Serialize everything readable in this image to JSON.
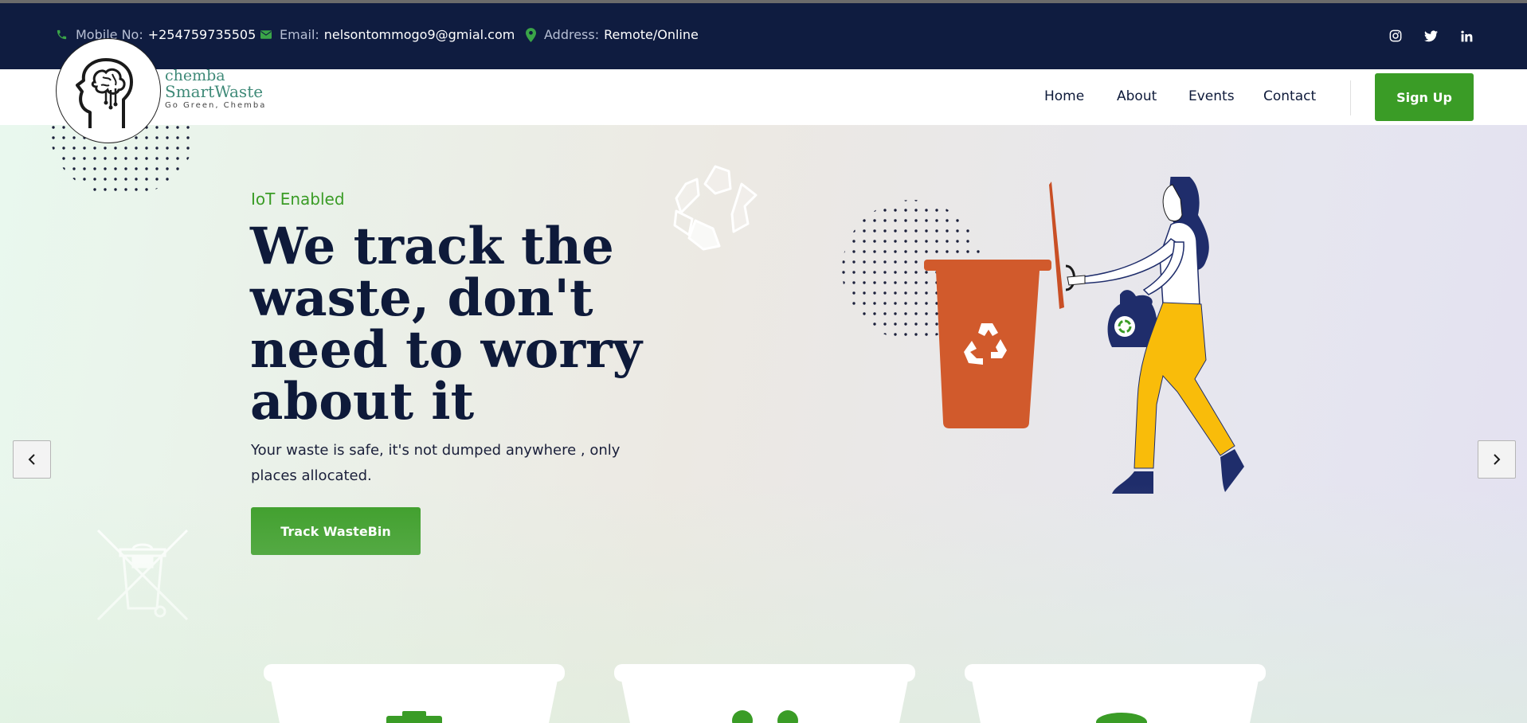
{
  "topbar": {
    "mobile_label": "Mobile No:",
    "mobile_value": "+254759735505",
    "email_label": "Email:",
    "email_value": "nelsontommogo9@gmial.com",
    "address_label": "Address:",
    "address_value": "Remote/Online",
    "social": [
      "instagram-icon",
      "twitter-icon",
      "linkedin-icon"
    ]
  },
  "logo": {
    "brand": "chemba",
    "name": "SmartWaste",
    "tagline": "Go Green, Chemba"
  },
  "nav": {
    "items": [
      "Home",
      "About",
      "Events",
      "Contact"
    ],
    "signup": "Sign Up"
  },
  "hero": {
    "eyebrow": "IoT Enabled",
    "headline": "We track the waste, don't need to worry about it",
    "subtext": "Your waste is safe, it's not dumped anywhere , only places allocated.",
    "cta": "Track WasteBin"
  },
  "colors": {
    "navy": "#0f1c40",
    "accent_green": "#3a9c26",
    "bin_orange": "#d15a2c",
    "pants_yellow": "#f9bc0a"
  }
}
